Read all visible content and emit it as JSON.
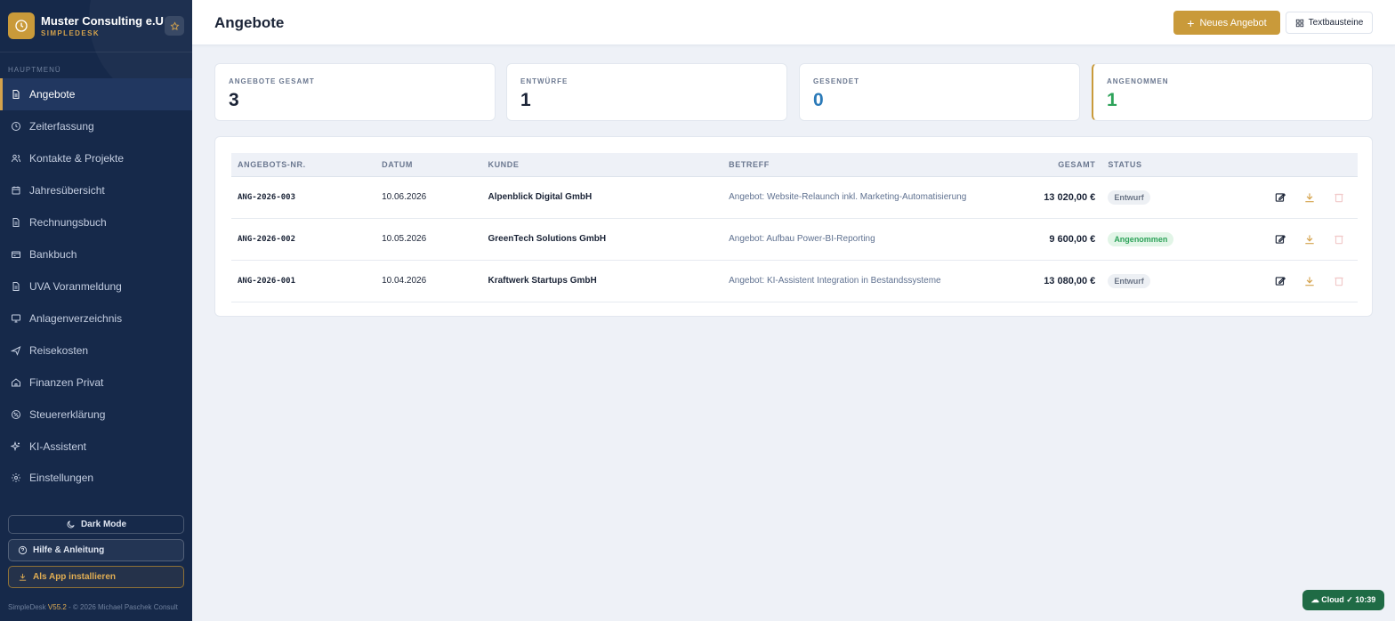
{
  "brand": {
    "name": "Muster Consulting e.U",
    "subtitle": "SIMPLEDESK"
  },
  "sidebar": {
    "heading": "HAUPTMENÜ",
    "items": [
      {
        "label": "Angebote",
        "icon": "document-icon",
        "active": true
      },
      {
        "label": "Zeiterfassung",
        "icon": "clock-icon"
      },
      {
        "label": "Kontakte & Projekte",
        "icon": "users-icon"
      },
      {
        "label": "Jahresübersicht",
        "icon": "calendar-icon"
      },
      {
        "label": "Rechnungsbuch",
        "icon": "document-icon"
      },
      {
        "label": "Bankbuch",
        "icon": "bank-card-icon"
      },
      {
        "label": "UVA Voranmeldung",
        "icon": "document-icon"
      },
      {
        "label": "Anlagenverzeichnis",
        "icon": "monitor-icon"
      },
      {
        "label": "Reisekosten",
        "icon": "plane-icon"
      },
      {
        "label": "Finanzen Privat",
        "icon": "home-icon"
      },
      {
        "label": "Steuererklärung",
        "icon": "percent-icon"
      },
      {
        "label": "KI-Assistent",
        "icon": "sparkle-icon"
      },
      {
        "label": "Einstellungen",
        "icon": "gear-icon"
      }
    ],
    "dark_mode_label": "Dark Mode",
    "help_label": "Hilfe & Anleitung",
    "install_label": "Als App installieren",
    "footer_prefix": "SimpleDesk ",
    "footer_version": "V55.2",
    "footer_suffix": " - © 2026 Michael Paschek Consult"
  },
  "header": {
    "title": "Angebote",
    "new_button": "Neues Angebot",
    "text_button": "Textbausteine"
  },
  "stats": [
    {
      "label": "ANGEBOTE GESAMT",
      "value": "3"
    },
    {
      "label": "ENTWÜRFE",
      "value": "1"
    },
    {
      "label": "GESENDET",
      "value": "0"
    },
    {
      "label": "ANGENOMMEN",
      "value": "1"
    }
  ],
  "table": {
    "columns": [
      "ANGEBOTS-NR.",
      "DATUM",
      "KUNDE",
      "BETREFF",
      "GESAMT",
      "STATUS"
    ],
    "rows": [
      {
        "nr": "ANG-2026-003",
        "datum": "10.06.2026",
        "kunde": "Alpenblick Digital GmbH",
        "betreff": "Angebot: Website-Relaunch inkl. Marketing-Automatisierung",
        "gesamt": "13 020,00 €",
        "status": "Entwurf"
      },
      {
        "nr": "ANG-2026-002",
        "datum": "10.05.2026",
        "kunde": "GreenTech Solutions GmbH",
        "betreff": "Angebot: Aufbau Power-BI-Reporting",
        "gesamt": "9 600,00 €",
        "status": "Angenommen"
      },
      {
        "nr": "ANG-2026-001",
        "datum": "10.04.2026",
        "kunde": "Kraftwerk Startups GmbH",
        "betreff": "Angebot: KI-Assistent Integration in Bestandssysteme",
        "gesamt": "13 080,00 €",
        "status": "Entwurf"
      }
    ]
  },
  "cloud_status": "☁ Cloud ✓ 10:39",
  "colors": {
    "sidebar": "#16294a",
    "accent": "#c99a3a",
    "positive": "#2ea35a",
    "info": "#2b7ab8"
  }
}
